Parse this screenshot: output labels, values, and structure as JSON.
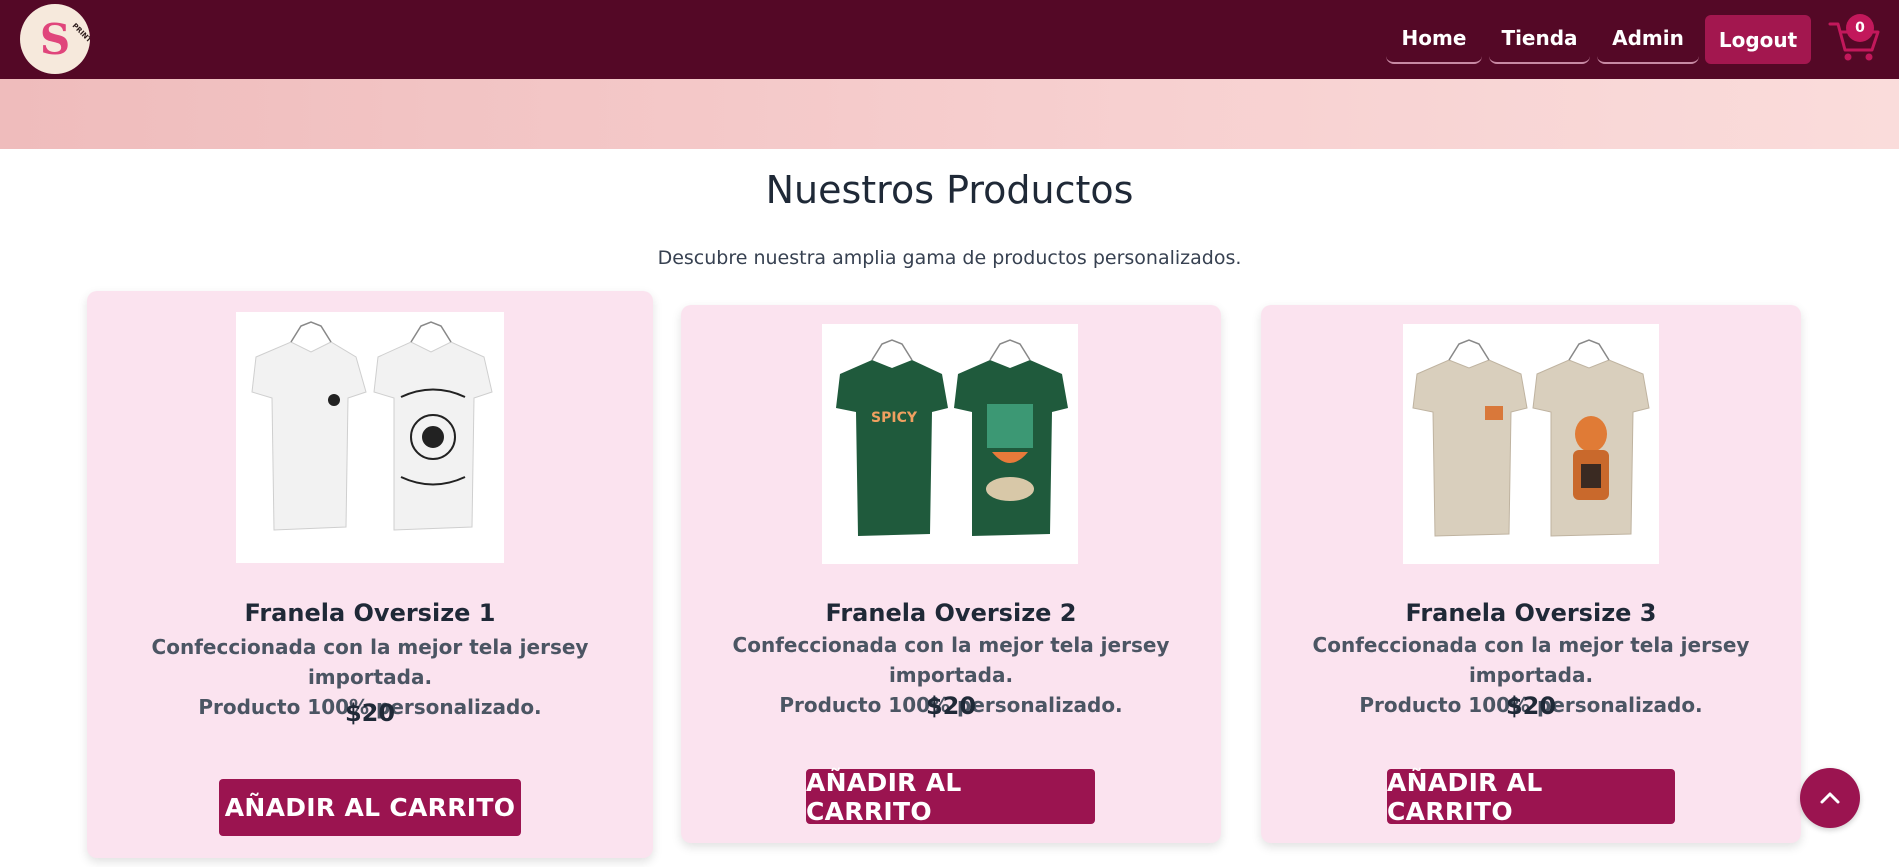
{
  "header": {
    "logo_icon": "s-print-logo",
    "nav": {
      "home": "Home",
      "tienda": "Tienda",
      "admin": "Admin"
    },
    "logout": "Logout",
    "cart": {
      "icon": "cart-icon",
      "count": "0"
    },
    "colors": {
      "bar": "#540826",
      "accent": "#a3174f"
    }
  },
  "main": {
    "title": "Nuestros Productos",
    "subtitle": "Descubre nuestra amplia gama de productos personalizados."
  },
  "products": [
    {
      "name": "Franela Oversize 1",
      "desc_line1": "Confeccionada con la mejor tela jersey importada.",
      "desc_line2": "Producto 100% personalizado.",
      "price": "$20",
      "button": "AÑADIR AL CARRITO",
      "shirt_color": "#f1f1f1",
      "front_label": "",
      "image_icon": "white-tshirts-image"
    },
    {
      "name": "Franela Oversize 2",
      "desc_line1": "Confeccionada con la mejor tela jersey importada.",
      "desc_line2": "Producto 100% personalizado.",
      "price": "$20",
      "button": "AÑADIR AL CARRITO",
      "shirt_color": "#1f5a3c",
      "front_label": "SPICY",
      "image_icon": "green-tshirts-image"
    },
    {
      "name": "Franela Oversize 3",
      "desc_line1": "Confeccionada con la mejor tela jersey importada.",
      "desc_line2": "Producto 100% personalizado.",
      "price": "$20",
      "button": "AÑADIR AL CARRITO",
      "shirt_color": "#d9cfbd",
      "front_label": "",
      "image_icon": "beige-tshirts-image"
    }
  ],
  "scroll_top_icon": "chevron-up-icon"
}
